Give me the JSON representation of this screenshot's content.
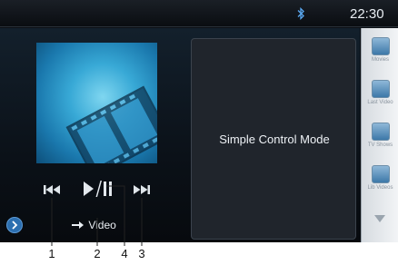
{
  "status_bar": {
    "time": "22:30",
    "bluetooth_icon": "bluetooth-icon"
  },
  "video_panel": {
    "mode_text": "Simple Control Mode"
  },
  "controls": {
    "prev_icon": "skip-previous-icon",
    "play_pause_icon": "play-pause-icon",
    "next_icon": "skip-next-icon",
    "more_icon": "chevron-right-icon",
    "video_link_icon": "arrow-right-icon",
    "video_link_label": "Video"
  },
  "side_rail": {
    "items": [
      {
        "label": "Movies",
        "icon": "film-icon"
      },
      {
        "label": "Last Video",
        "icon": "last-video-icon"
      },
      {
        "label": "TV Shows",
        "icon": "tv-shows-icon"
      },
      {
        "label": "Lib Videos",
        "icon": "library-icon"
      }
    ],
    "scroll_icon": "triangle-down-icon"
  },
  "callouts": [
    "1",
    "2",
    "4",
    "3"
  ],
  "colors": {
    "accent": "#2c6fb0",
    "thumbnail": "#38a9d6"
  }
}
